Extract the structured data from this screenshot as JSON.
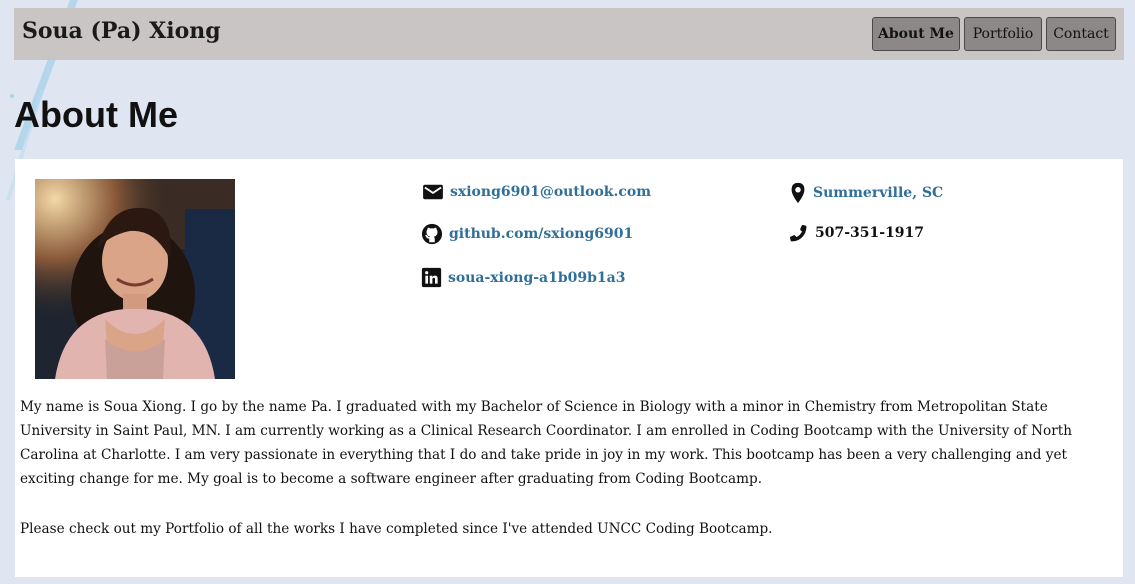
{
  "header": {
    "brand": "Soua (Pa) Xiong",
    "nav": [
      {
        "label": "About Me",
        "active": true
      },
      {
        "label": "Portfolio",
        "active": false
      },
      {
        "label": "Contact",
        "active": false
      }
    ]
  },
  "main": {
    "heading": "About Me",
    "contacts": {
      "email": {
        "icon": "mail-icon",
        "text": "sxiong6901@outlook.com"
      },
      "github": {
        "icon": "github-icon",
        "text": "github.com/sxiong6901"
      },
      "linkedin": {
        "icon": "linkedin-icon",
        "text": "soua-xiong-a1b09b1a3"
      },
      "location": {
        "icon": "location-pin-icon",
        "text": "Summerville, SC"
      },
      "phone": {
        "icon": "phone-icon",
        "text": "507-351-1917"
      }
    },
    "bio": [
      "My name is Soua Xiong. I go by the name Pa. I graduated with my Bachelor of Science in Biology with a minor in Chemistry from Metropolitan State University in Saint Paul, MN. I am currently working as a Clinical Research Coordinator. I am enrolled in Coding Bootcamp with the University of North Carolina at Charlotte. I am very passionate in everything that I do and take pride in joy in my work. This bootcamp has been a very challenging and yet exciting change for me. My goal is to become a software engineer after graduating from Coding Bootcamp.",
      "Please check out my Portfolio of all the works I have completed since I've attended UNCC Coding Bootcamp."
    ]
  },
  "colors": {
    "page_bg": "#dfe6f1",
    "navbar_bg": "#c9c5c5",
    "nav_button_bg": "#8c8888",
    "link": "#2f6f99"
  }
}
